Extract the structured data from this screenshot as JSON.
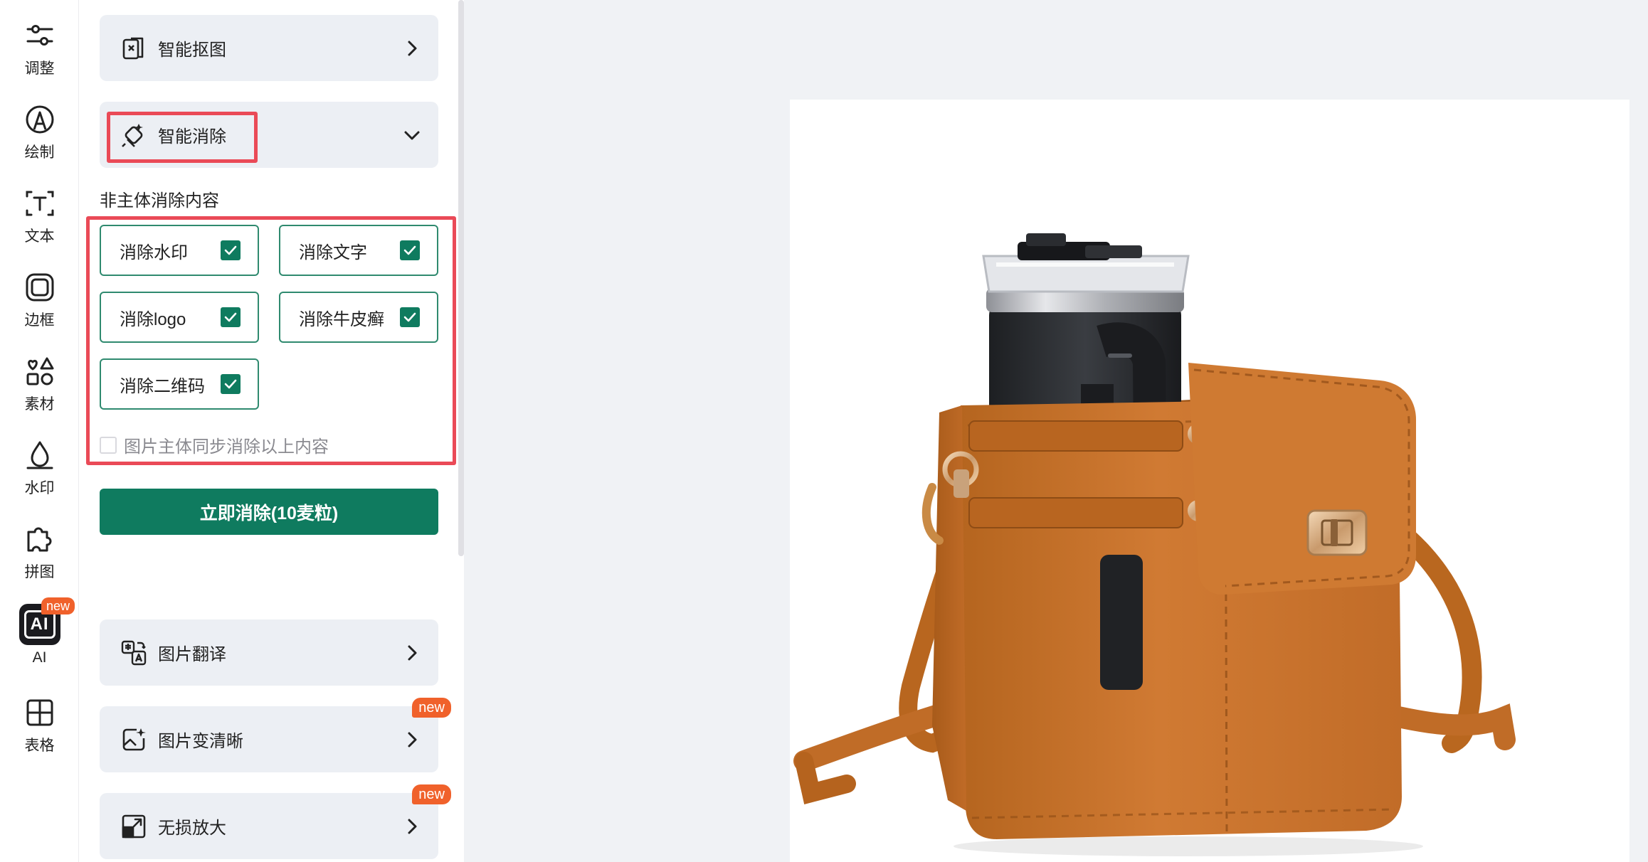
{
  "rail": {
    "items": [
      {
        "label": "调整",
        "icon": "sliders-icon"
      },
      {
        "label": "绘制",
        "icon": "draw-icon"
      },
      {
        "label": "文本",
        "icon": "text-icon"
      },
      {
        "label": "边框",
        "icon": "frame-icon"
      },
      {
        "label": "素材",
        "icon": "shapes-icon"
      },
      {
        "label": "水印",
        "icon": "watermark-icon"
      },
      {
        "label": "拼图",
        "icon": "puzzle-icon"
      },
      {
        "label": "AI",
        "icon": "ai-icon",
        "badge": "new",
        "active": true
      },
      {
        "label": "表格",
        "icon": "table-icon"
      }
    ]
  },
  "panel": {
    "cutout": {
      "label": "智能抠图"
    },
    "erase": {
      "label": "智能消除",
      "expanded": true
    },
    "section_label": "非主体消除内容",
    "options": [
      {
        "label": "消除水印",
        "checked": true
      },
      {
        "label": "消除文字",
        "checked": true
      },
      {
        "label": "消除logo",
        "checked": true
      },
      {
        "label": "消除牛皮癣",
        "checked": true
      },
      {
        "label": "消除二维码",
        "checked": true
      }
    ],
    "sync_label": "图片主体同步消除以上内容",
    "sync_checked": false,
    "action_button": "立即消除(10麦粒)",
    "translate": {
      "label": "图片翻译"
    },
    "sharpen": {
      "label": "图片变清晰",
      "badge": "new"
    },
    "upscale": {
      "label": "无损放大",
      "badge": "new"
    }
  },
  "colors": {
    "accent": "#0f7b5f",
    "highlight": "#ea4a57",
    "badge": "#f0612b",
    "card_bg": "#eceff4",
    "leather": "#c8742f"
  }
}
